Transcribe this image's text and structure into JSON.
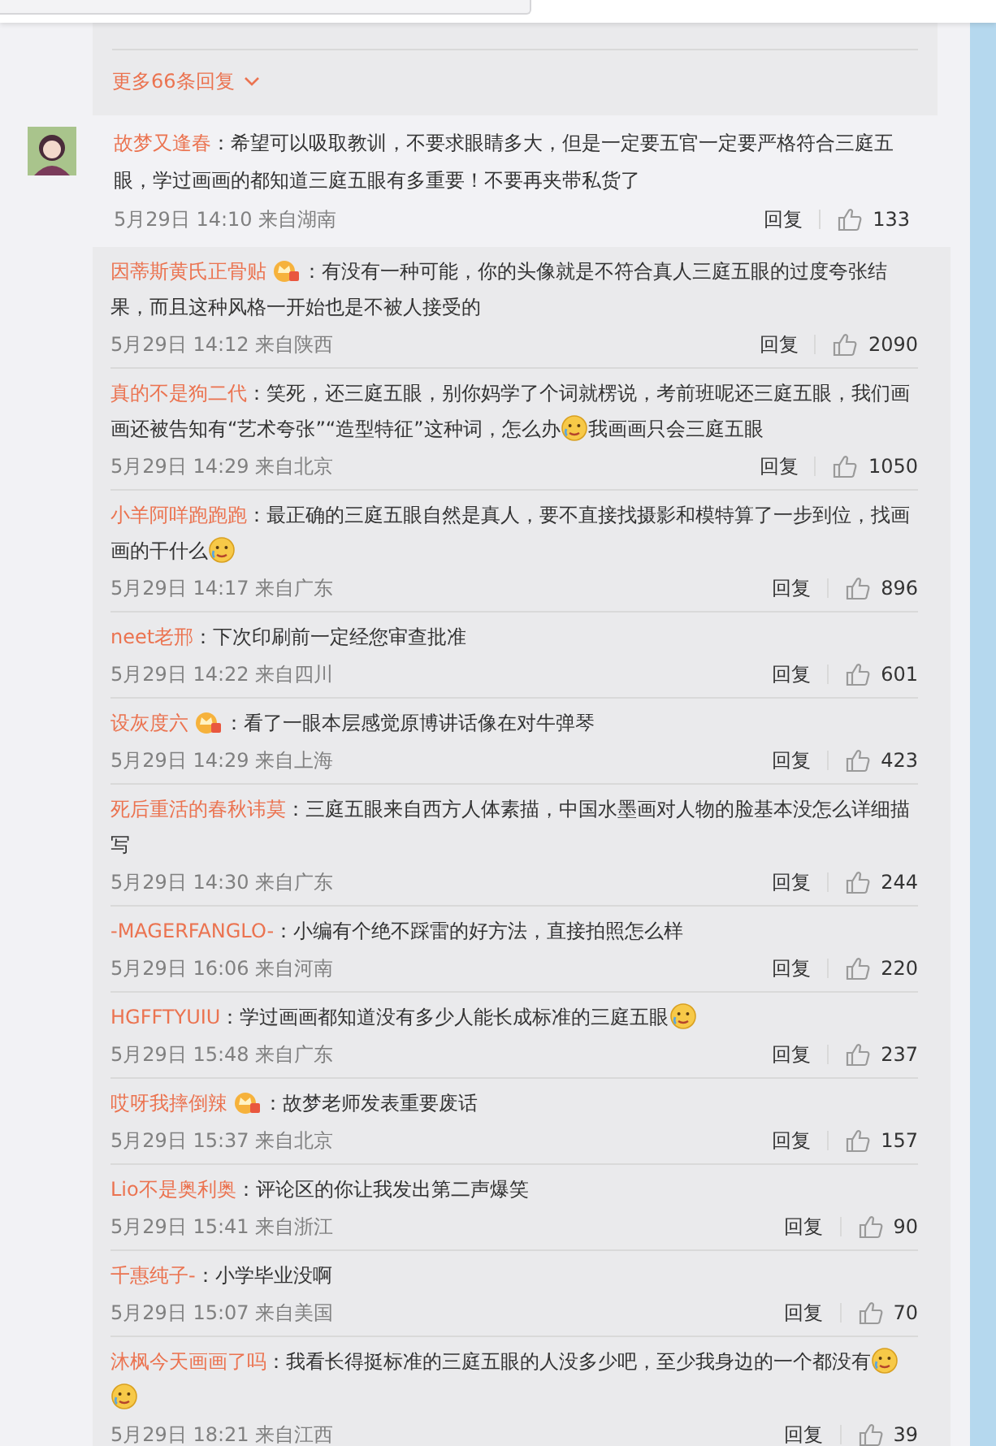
{
  "thread": {
    "more": "更多66条回复"
  },
  "comment": {
    "author": "故梦又逢春",
    "content": [
      {
        "kind": "text",
        "text": "：希望可以吸取教训，不要求眼睛多大，但是一定要五官一定要严格符合三庭五眼，学过画画的都知道三庭五眼有多重要！不要再夹带私货了"
      }
    ],
    "time": "5月29日 14:10 来自湖南",
    "reply": "回复",
    "likes": "133"
  },
  "replies": [
    {
      "author": "因蒂斯黄氏正骨贴",
      "badge": true,
      "content": [
        {
          "kind": "text",
          "text": "：有没有一种可能，你的头像就是不符合真人三庭五眼的过度夸张结果，而且这种风格一开始也是不被人接受的"
        }
      ],
      "time": "5月29日 14:12 来自陕西",
      "reply": "回复",
      "likes": "2090"
    },
    {
      "author": "真的不是狗二代",
      "badge": false,
      "content": [
        {
          "kind": "text",
          "text": "：笑死，还三庭五眼，别你妈学了个词就楞说，考前班呢还三庭五眼，我们画画还被告知有“艺术夸张”“造型特征”这种词，怎么办"
        },
        {
          "kind": "emoji"
        },
        {
          "kind": "text",
          "text": "我画画只会三庭五眼"
        }
      ],
      "time": "5月29日 14:29 来自北京",
      "reply": "回复",
      "likes": "1050"
    },
    {
      "author": "小羊阿咩跑跑跑",
      "badge": false,
      "content": [
        {
          "kind": "text",
          "text": "：最正确的三庭五眼自然是真人，要不直接找摄影和模特算了一步到位，找画画的干什么"
        },
        {
          "kind": "emoji"
        }
      ],
      "time": "5月29日 14:17 来自广东",
      "reply": "回复",
      "likes": "896"
    },
    {
      "author": "neet老邢",
      "badge": false,
      "content": [
        {
          "kind": "text",
          "text": "：下次印刷前一定经您审查批准"
        }
      ],
      "time": "5月29日 14:22 来自四川",
      "reply": "回复",
      "likes": "601"
    },
    {
      "author": "设灰度六",
      "badge": true,
      "content": [
        {
          "kind": "text",
          "text": "：看了一眼本层感觉原博讲话像在对牛弹琴"
        }
      ],
      "time": "5月29日 14:29 来自上海",
      "reply": "回复",
      "likes": "423"
    },
    {
      "author": "死后重活的春秋讳莫",
      "badge": false,
      "content": [
        {
          "kind": "text",
          "text": "：三庭五眼来自西方人体素描，中国水墨画对人物的脸基本没怎么详细描写"
        }
      ],
      "time": "5月29日 14:30 来自广东",
      "reply": "回复",
      "likes": "244"
    },
    {
      "author": "-MAGERFANGLO-",
      "badge": false,
      "content": [
        {
          "kind": "text",
          "text": "：小编有个绝不踩雷的好方法，直接拍照怎么样"
        }
      ],
      "time": "5月29日 16:06 来自河南",
      "reply": "回复",
      "likes": "220"
    },
    {
      "author": "HGFFTYUIU",
      "badge": false,
      "content": [
        {
          "kind": "text",
          "text": "：学过画画都知道没有多少人能长成标准的三庭五眼"
        },
        {
          "kind": "emoji"
        }
      ],
      "time": "5月29日 15:48 来自广东",
      "reply": "回复",
      "likes": "237"
    },
    {
      "author": "哎呀我摔倒辣",
      "badge": true,
      "content": [
        {
          "kind": "text",
          "text": "：故梦老师发表重要废话"
        }
      ],
      "time": "5月29日 15:37 来自北京",
      "reply": "回复",
      "likes": "157"
    },
    {
      "author": "Lio不是奥利奥",
      "badge": false,
      "content": [
        {
          "kind": "text",
          "text": "：评论区的你让我发出第二声爆笑"
        }
      ],
      "time": "5月29日 15:41 来自浙江",
      "reply": "回复",
      "likes": "90"
    },
    {
      "author": "千惠纯子-",
      "badge": false,
      "content": [
        {
          "kind": "text",
          "text": "：小学毕业没啊"
        }
      ],
      "time": "5月29日 15:07 来自美国",
      "reply": "回复",
      "likes": "70"
    },
    {
      "author": "沐枫今天画画了吗",
      "badge": false,
      "content": [
        {
          "kind": "text",
          "text": "：我看长得挺标准的三庭五眼的人没多少吧，至少我身边的一个都没有"
        },
        {
          "kind": "emoji"
        },
        {
          "kind": "emoji"
        }
      ],
      "time": "5月29日 18:21 来自江西",
      "reply": "回复",
      "likes": "39"
    }
  ]
}
